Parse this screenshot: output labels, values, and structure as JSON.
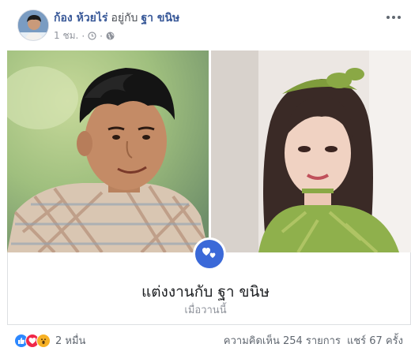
{
  "post": {
    "author": "ก้อง ห้วยไร่",
    "with_text": "อยู่กับ",
    "tagged": "ฐา ขนิษ",
    "time": "1 ชม.",
    "meta_separator": "·",
    "privacy_icon": "globe-icon"
  },
  "life_event": {
    "title": "แต่งงานกับ ฐา ขนิษ",
    "date": "เมื่อวานนี้",
    "icon": "heart-icon",
    "accent_color": "#3b69d8"
  },
  "footer": {
    "reactions": [
      "like",
      "love",
      "wow"
    ],
    "reaction_count": "2 หมื่น",
    "comments": "ความคิดเห็น 254 รายการ",
    "shares": "แชร์ 67 ครั้ง"
  },
  "colors": {
    "link": "#385898",
    "secondary_text": "#90949c"
  }
}
